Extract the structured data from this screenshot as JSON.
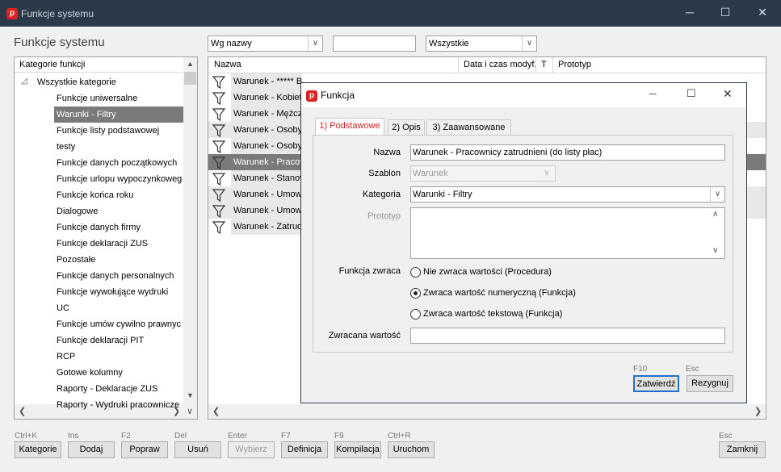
{
  "window": {
    "title": "Funkcje systemu"
  },
  "heading": "Funkcje systemu",
  "filters": {
    "sort": "Wg nazwy",
    "search": "",
    "scope": "Wszystkie"
  },
  "categories": {
    "header": "Kategorie funkcji",
    "root": "Wszystkie kategorie",
    "items": [
      "Funkcje uniwersalne",
      "Warunki - Filtry",
      "Funkcje listy podstawowej",
      "testy",
      "Funkcje danych początkowych",
      "Funkcje urlopu wypoczynkoweg",
      "Funkcje końca roku",
      "Dialogowe",
      "Funkcje danych firmy",
      "Funkcje deklaracji ZUS",
      "Pozostałe",
      "Funkcje danych personalnych",
      "Funkcje wywołujące wydruki",
      "UC",
      "Funkcje umów cywilno prawnyc",
      "Funkcje deklaracji PIT",
      "RCP",
      "Gotowe kolumny",
      "Raporty - Deklaracje ZUS",
      "Raporty - Wydruki pracownicze"
    ]
  },
  "list": {
    "columns": [
      "Nazwa",
      "Data i czas modyf.",
      "T",
      "Prototyp"
    ],
    "rows": [
      "Warunek - ***** Bez filtra *****",
      "Warunek - Kobiety",
      "Warunek - Mężczyźni",
      "Warunek - Osoby",
      "Warunek - Osoby",
      "Warunek - Pracownicy",
      "Warunek - Stanowisko",
      "Warunek - Umowy",
      "Warunek - Umowy",
      "Warunek - Zatrudnieni"
    ]
  },
  "bottom": {
    "buttons": [
      {
        "shortcut": "Ctrl+K",
        "label": "Kategorie"
      },
      {
        "shortcut": "Ins",
        "label": "Dodaj"
      },
      {
        "shortcut": "F2",
        "label": "Popraw"
      },
      {
        "shortcut": "Del",
        "label": "Usuń"
      },
      {
        "shortcut": "Enter",
        "label": "Wybierz"
      },
      {
        "shortcut": "F7",
        "label": "Definicja"
      },
      {
        "shortcut": "F9",
        "label": "Kompilacja"
      },
      {
        "shortcut": "Ctrl+R",
        "label": "Uruchom"
      }
    ],
    "close": {
      "shortcut": "Esc",
      "label": "Zamknij"
    }
  },
  "dialog": {
    "title": "Funkcja",
    "tabs": [
      "1) Podstawowe",
      "2) Opis",
      "3) Zaawansowane"
    ],
    "labels": {
      "name": "Nazwa",
      "template": "Szablon",
      "category": "Kategoria",
      "prototype": "Prototyp",
      "returns": "Funkcja zwraca",
      "returned_value": "Zwracana wartość"
    },
    "values": {
      "name": "Warunek - Pracownicy zatrudnieni (do listy płac)",
      "template": "Warunek",
      "category": "Warunki - Filtry",
      "prototype": "",
      "returned_value": ""
    },
    "radios": [
      {
        "label": "Nie zwraca wartości (Procedura)",
        "checked": false
      },
      {
        "label": "Zwraca wartość numeryczną (Funkcja)",
        "checked": true
      },
      {
        "label": "Zwraca wartość tekstową (Funkcja)",
        "checked": false
      }
    ],
    "buttons": {
      "ok": {
        "shortcut": "F10",
        "label": "Zatwierdź"
      },
      "cancel": {
        "shortcut": "Esc",
        "label": "Rezygnuj"
      }
    }
  },
  "colors": {
    "titlebar": "#2b3a4a",
    "selection": "#7a7a7a",
    "logo": "#e02020",
    "active_tab": "#d02020"
  }
}
